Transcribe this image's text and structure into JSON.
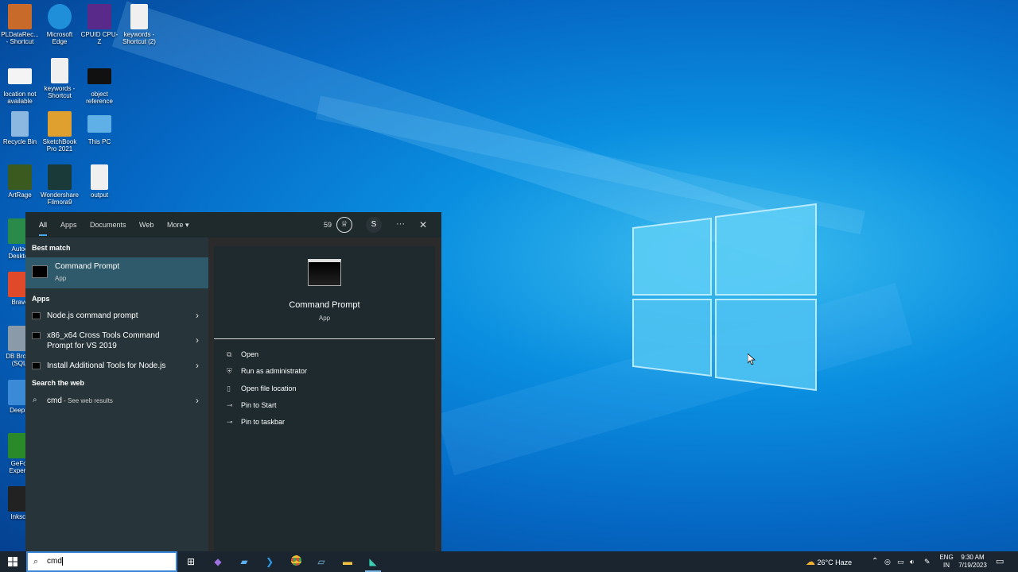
{
  "desktop": {
    "icons": [
      {
        "label": "PLDataRec... - Shortcut",
        "color": "#c86a2a"
      },
      {
        "label": "Microsoft Edge",
        "color": "#1e8fd8"
      },
      {
        "label": "CPUID CPU-Z",
        "color": "#5a2a8a"
      },
      {
        "label": "keywords - Shortcut (2)",
        "color": "#f0f0f0"
      },
      {
        "label": "location not available",
        "color": "#f4f4f4"
      },
      {
        "label": "keywords - Shortcut",
        "color": "#f0f0f0"
      },
      {
        "label": "object reference",
        "color": "#111111"
      },
      {
        "label": "Recycle Bin",
        "color": "#8ab8e0"
      },
      {
        "label": "SketchBook Pro 2021",
        "color": "#e0a030"
      },
      {
        "label": "This PC",
        "color": "#60b0e8"
      },
      {
        "label": "ArtRage",
        "color": "#3a5a20"
      },
      {
        "label": "Wondershare Filmora9",
        "color": "#1a3a3a"
      },
      {
        "label": "output",
        "color": "#f0f0f0"
      },
      {
        "label": "Autod Desktop",
        "color": "#2a8a4a"
      },
      {
        "label": "Brave",
        "color": "#e04a2a"
      },
      {
        "label": "DB Brows (SQLi",
        "color": "#8a9aa8"
      },
      {
        "label": "DeepM",
        "color": "#3a8ad8"
      },
      {
        "label": "GeFor Experie",
        "color": "#2a8a2a"
      },
      {
        "label": "Inksca",
        "color": "#222222"
      }
    ]
  },
  "search_panel": {
    "tabs": [
      {
        "label": "All",
        "active": true
      },
      {
        "label": "Apps"
      },
      {
        "label": "Documents"
      },
      {
        "label": "Web"
      },
      {
        "label": "More"
      }
    ],
    "more_chevron": "▾",
    "reward_points": "59",
    "avatar_letter": "S",
    "more_options": "···",
    "close": "✕",
    "best_match_heading": "Best match",
    "best_match": {
      "name": "Command Prompt",
      "type": "App"
    },
    "apps_heading": "Apps",
    "apps": [
      {
        "name": "Node.js command prompt"
      },
      {
        "name": "x86_x64 Cross Tools Command Prompt for VS 2019"
      },
      {
        "name": "Install Additional Tools for Node.js"
      }
    ],
    "web_heading": "Search the web",
    "web_result": {
      "query": "cmd",
      "suffix": " - See web results"
    },
    "preview": {
      "name": "Command Prompt",
      "type": "App"
    },
    "actions": [
      {
        "label": "Open",
        "icon": "open-icon"
      },
      {
        "label": "Run as administrator",
        "icon": "shield-icon"
      },
      {
        "label": "Open file location",
        "icon": "file-icon"
      },
      {
        "label": "Pin to Start",
        "icon": "pin-icon"
      },
      {
        "label": "Pin to taskbar",
        "icon": "pin-icon"
      }
    ]
  },
  "taskbar": {
    "search_value": "cmd",
    "weather": "26°C Haze",
    "language": "ENG",
    "region": "IN",
    "time": "9:30 AM",
    "date": "7/19/2023"
  }
}
